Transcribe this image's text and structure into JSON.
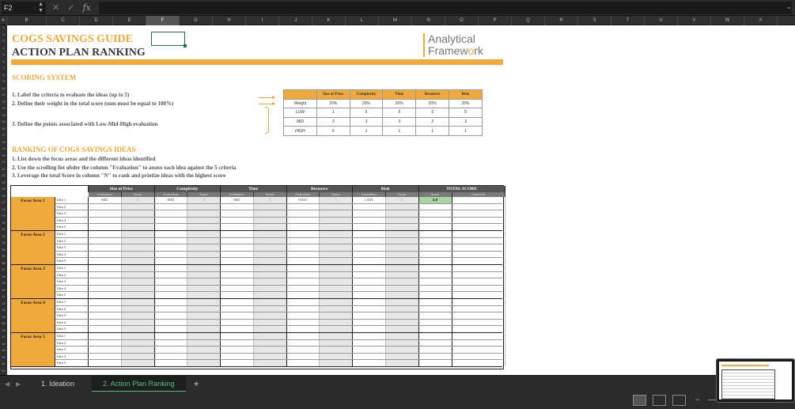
{
  "formula_bar": {
    "cell_ref": "F2",
    "fx_label": "fx"
  },
  "columns": [
    "A",
    "B",
    "C",
    "D",
    "E",
    "F",
    "G",
    "H",
    "I",
    "J",
    "K",
    "L",
    "M",
    "N",
    "O",
    "P",
    "Q",
    "R",
    "S",
    "T",
    "U",
    "V",
    "W",
    "X"
  ],
  "selected_column": "F",
  "sheet": {
    "title1": "COGS SAVINGS GUIDE",
    "title2": "ACTION PLAN RANKING",
    "logo_line1": "Analytical",
    "logo_line2a": "Framew",
    "logo_o": "o",
    "logo_line2b": "rk",
    "scoring_heading": "SCORING SYSTEM",
    "scoring_steps": [
      "1. Label the criteria to evaluate the ideas (up to 5)",
      "2. Define their weight in the total score (sum must be equal to 100%)",
      "3. Define the points associated with Low-Mid-High evaluation"
    ],
    "ranking_heading": "RANKING OF COGS SAVINGS IDEAS",
    "ranking_steps": [
      "1. List down the focus areas and the different ideas identified",
      "2. Use the scrolling list ubder the column \"Evaluation\" to assess each idea against the 5 criteria",
      "3. Leverage the total Score in column \"N\" to rank and priotize ideas with the highest score"
    ]
  },
  "scoring_table": {
    "headers": [
      "",
      "Size of Price",
      "Complexity",
      "Time",
      "Resource",
      "Risk"
    ],
    "rows": [
      {
        "label": "Weight",
        "values": [
          "20%",
          "20%",
          "20%",
          "20%",
          "20%"
        ]
      },
      {
        "label": "LOW",
        "values": [
          "1",
          "5",
          "5",
          "5",
          "5"
        ]
      },
      {
        "label": "MID",
        "values": [
          "3",
          "3",
          "3",
          "3",
          "3"
        ]
      },
      {
        "label": "HIGH",
        "values": [
          "5",
          "1",
          "1",
          "1",
          "1"
        ]
      }
    ]
  },
  "ranking_table": {
    "criteria": [
      "Size of Price",
      "Complexity",
      "Time",
      "Resource",
      "Risk"
    ],
    "total_label": "TOTAL SCORE",
    "sub_eval": "Evaluation",
    "sub_score": "Score",
    "sub_total_score": "Score",
    "sub_comment": "Comment",
    "focus_areas": [
      {
        "name": "Focus Area 1",
        "ideas": [
          "Idea 1",
          "Idea 2",
          "Idea 3",
          "Idea 4",
          "Idea 5"
        ]
      },
      {
        "name": "Focus Area 2",
        "ideas": [
          "Idea 1",
          "Idea 2",
          "Idea 3",
          "Idea 4",
          "Idea 5"
        ]
      },
      {
        "name": "Focus Area 3",
        "ideas": [
          "Idea 1",
          "Idea 2",
          "Idea 3",
          "Idea 4",
          "Idea 5"
        ]
      },
      {
        "name": "Focus Area 4",
        "ideas": [
          "Idea 1",
          "Idea 2",
          "Idea 3",
          "Idea 4",
          "Idea 5"
        ]
      },
      {
        "name": "Focus Area 5",
        "ideas": [
          "Idea 1",
          "Idea 2",
          "Idea 3",
          "Idea 4",
          "Idea 5"
        ]
      }
    ],
    "first_row": {
      "evaluations": [
        "MID",
        "MID",
        "MID",
        "HIGH",
        "LOW"
      ],
      "scores": [
        "3",
        "3",
        "3",
        "1",
        "5"
      ],
      "total": "3,0"
    }
  },
  "tabs": [
    {
      "label": "1. Ideation",
      "active": false
    },
    {
      "label": "2. Action Plan Ranking",
      "active": true
    }
  ],
  "add_sheet_label": "+",
  "zoom_minus": "−",
  "accent_color": "#f0a93b",
  "highlight_color": "#a8d5a2"
}
